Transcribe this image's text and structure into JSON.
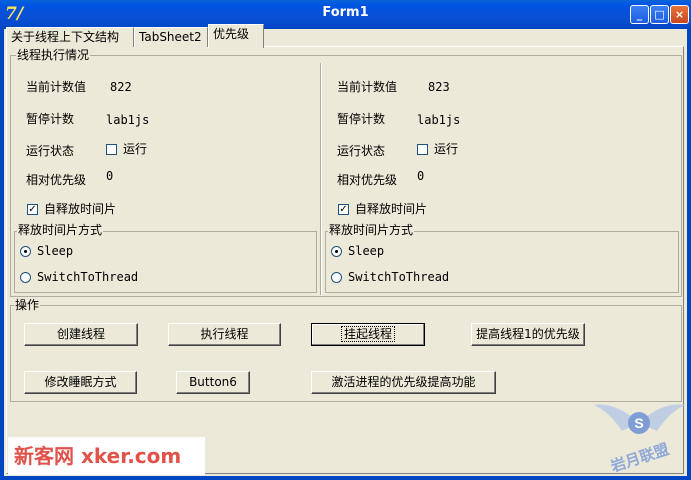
{
  "window": {
    "title": "Form1",
    "icon": "app-icon",
    "app_icon_glyph": "7/"
  },
  "caption_buttons": {
    "minimize": "_",
    "maximize": "□",
    "close": "×"
  },
  "tabs": [
    {
      "label": "关于线程上下文结构"
    },
    {
      "label": "TabSheet2"
    },
    {
      "label": "优先级"
    }
  ],
  "thread_group": {
    "title": "线程执行情况",
    "left": {
      "count_label": "当前计数值",
      "count_value": "822",
      "pause_label": "暂停计数",
      "pause_value": "lab1js",
      "state_label": "运行状态",
      "running_label": "运行",
      "priority_label": "相对优先级",
      "priority_value": "0",
      "auto_release_label": "自释放时间片",
      "release_group_title": "释放时间片方式",
      "sleep_label": "Sleep",
      "switch_label": "SwitchToThread"
    },
    "right": {
      "count_label": "当前计数值",
      "count_value": "823",
      "pause_label": "暂停计数",
      "pause_value": "lab1js",
      "state_label": "运行状态",
      "running_label": "运行",
      "priority_label": "相对优先级",
      "priority_value": "0",
      "auto_release_label": "自释放时间片",
      "release_group_title": "释放时间片方式",
      "sleep_label": "Sleep",
      "switch_label": "SwitchToThread"
    }
  },
  "operations": {
    "title": "操作",
    "create": "创建线程",
    "execute": "执行线程",
    "suspend": "挂起线程",
    "raise_priority": "提高线程1的优先级",
    "change_sleep": "修改睡眠方式",
    "button6": "Button6",
    "activate_boost": "激活进程的优先级提高功能"
  },
  "watermark": {
    "left_text": "新客网 xker.com",
    "right_text": "S",
    "right_caption": "岩月联盟"
  },
  "colors": {
    "titlebar": "#0054e3",
    "window_bg": "#ece9d8",
    "watermark_red": "#e0524a"
  }
}
